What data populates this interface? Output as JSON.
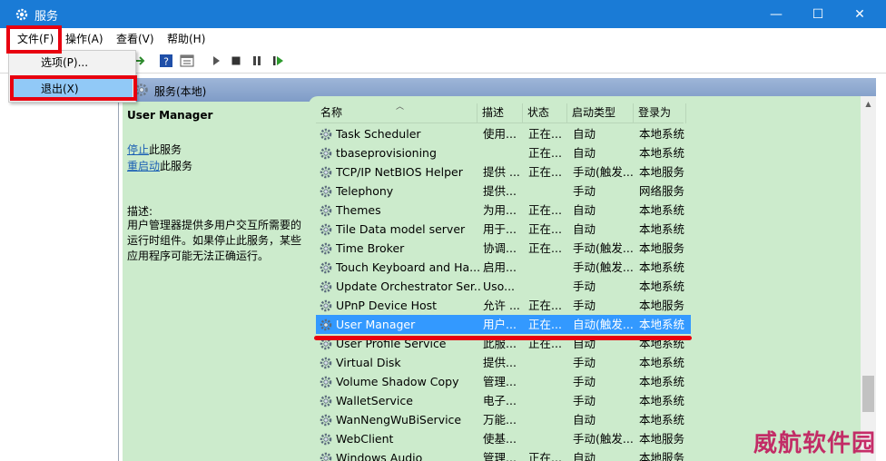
{
  "window": {
    "title": "服务",
    "minimize_glyph": "—",
    "maximize_glyph": "☐",
    "close_glyph": "✕",
    "titlebar_color": "#1a7bd6"
  },
  "menubar": {
    "items": [
      "文件(F)",
      "操作(A)",
      "查看(V)",
      "帮助(H)"
    ]
  },
  "file_menu": {
    "items": [
      "选项(P)...",
      "退出(X)"
    ],
    "highlighted": "退出(X)"
  },
  "toolbar": {
    "icons": [
      "back-icon",
      "forward-icon",
      "up-icon",
      "help-icon",
      "properties-icon",
      "play-icon",
      "stop-icon",
      "pause-icon",
      "restart-icon"
    ]
  },
  "pane": {
    "header_title": "服务(本地)"
  },
  "description_panel": {
    "service_name": "User Manager",
    "stop_link": "停止",
    "stop_suffix": "此服务",
    "restart_link": "重启动",
    "restart_suffix": "此服务",
    "desc_label": "描述:",
    "desc_text": "用户管理器提供多用户交互所需要的运行时组件。如果停止此服务，某些应用程序可能无法正确运行。"
  },
  "list": {
    "columns": [
      "名称",
      "描述",
      "状态",
      "启动类型",
      "登录为"
    ],
    "rows": [
      {
        "name": "Task Scheduler",
        "desc": "使用...",
        "status": "正在...",
        "startup": "自动",
        "logon": "本地系统"
      },
      {
        "name": "tbaseprovisioning",
        "desc": "",
        "status": "正在...",
        "startup": "自动",
        "logon": "本地系统"
      },
      {
        "name": "TCP/IP NetBIOS Helper",
        "desc": "提供 ...",
        "status": "正在...",
        "startup": "手动(触发...",
        "logon": "本地服务"
      },
      {
        "name": "Telephony",
        "desc": "提供...",
        "status": "",
        "startup": "手动",
        "logon": "网络服务"
      },
      {
        "name": "Themes",
        "desc": "为用...",
        "status": "正在...",
        "startup": "自动",
        "logon": "本地系统"
      },
      {
        "name": "Tile Data model server",
        "desc": "用于...",
        "status": "正在...",
        "startup": "自动",
        "logon": "本地系统"
      },
      {
        "name": "Time Broker",
        "desc": "协调...",
        "status": "正在...",
        "startup": "手动(触发...",
        "logon": "本地服务"
      },
      {
        "name": "Touch Keyboard and Ha...",
        "desc": "启用...",
        "status": "",
        "startup": "手动(触发...",
        "logon": "本地系统"
      },
      {
        "name": "Update Orchestrator Ser...",
        "desc": "Uso...",
        "status": "",
        "startup": "手动",
        "logon": "本地系统"
      },
      {
        "name": "UPnP Device Host",
        "desc": "允许 ...",
        "status": "正在...",
        "startup": "手动",
        "logon": "本地服务"
      },
      {
        "name": "User Manager",
        "desc": "用户...",
        "status": "正在...",
        "startup": "自动(触发...",
        "logon": "本地系统"
      },
      {
        "name": "User Profile Service",
        "desc": "此服...",
        "status": "正在...",
        "startup": "自动",
        "logon": "本地系统"
      },
      {
        "name": "Virtual Disk",
        "desc": "提供...",
        "status": "",
        "startup": "手动",
        "logon": "本地系统"
      },
      {
        "name": "Volume Shadow Copy",
        "desc": "管理...",
        "status": "",
        "startup": "手动",
        "logon": "本地系统"
      },
      {
        "name": "WalletService",
        "desc": "电子...",
        "status": "",
        "startup": "手动",
        "logon": "本地系统"
      },
      {
        "name": "WanNengWuBiService",
        "desc": "万能...",
        "status": "",
        "startup": "自动",
        "logon": "本地系统"
      },
      {
        "name": "WebClient",
        "desc": "使基...",
        "status": "",
        "startup": "手动(触发...",
        "logon": "本地服务"
      },
      {
        "name": "Windows Audio",
        "desc": "管理...",
        "status": "正在...",
        "startup": "自动",
        "logon": "本地服务"
      }
    ],
    "selected_name": "User Manager",
    "selection_color": "#3399ff",
    "panel_color": "#ccebcc"
  },
  "watermark": {
    "text": "威航软件园"
  },
  "annotation_color": "#e8000f"
}
